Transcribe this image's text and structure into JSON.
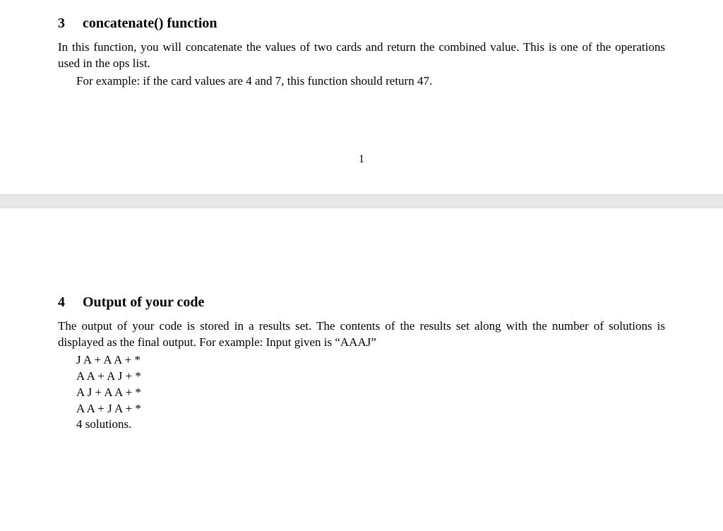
{
  "section3": {
    "number": "3",
    "title": "concatenate() function",
    "para1": "In this function, you will concatenate the values of two cards and return the combined value. This is one of the operations used in the ops list.",
    "para2": "For example: if the card values are 4 and 7, this function should return 47."
  },
  "page_number": "1",
  "section4": {
    "number": "4",
    "title": "Output of your code",
    "para1": "The output of your code is stored in a results set.  The contents of the results set along with the number of solutions is displayed as the final output. For example: Input given is “AAAJ”",
    "lines": [
      "J A + A A + *",
      "A A + A J + *",
      "A J + A A + *",
      "A A + J A + *",
      "4 solutions."
    ]
  }
}
